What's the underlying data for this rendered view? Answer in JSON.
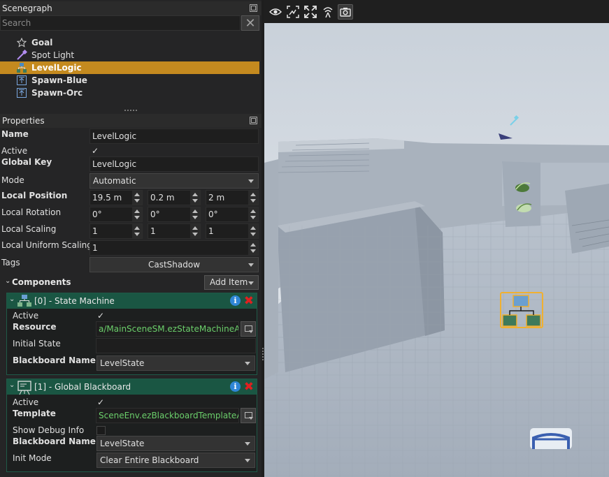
{
  "scenegraph": {
    "title": "Scenegraph",
    "search_placeholder": "Search",
    "items": [
      {
        "label": "Goal",
        "icon": "star-icon",
        "selected": false
      },
      {
        "label": "Spot Light",
        "icon": "spot-light-icon",
        "selected": false
      },
      {
        "label": "LevelLogic",
        "icon": "state-machine-icon",
        "selected": true
      },
      {
        "label": "Spawn-Blue",
        "icon": "spawn-point-icon",
        "selected": false
      },
      {
        "label": "Spawn-Orc",
        "icon": "spawn-point-icon",
        "selected": false
      }
    ]
  },
  "properties": {
    "title": "Properties",
    "name_label": "Name",
    "name_value": "LevelLogic",
    "active_label": "Active",
    "active_checked": "✓",
    "global_key_label": "Global Key",
    "global_key_value": "LevelLogic",
    "mode_label": "Mode",
    "mode_value": "Automatic",
    "local_position_label": "Local Position",
    "local_position": [
      "19.5 m",
      "0.2 m",
      "2 m"
    ],
    "local_rotation_label": "Local Rotation",
    "local_rotation": [
      "0°",
      "0°",
      "0°"
    ],
    "local_scaling_label": "Local Scaling",
    "local_scaling": [
      "1",
      "1",
      "1"
    ],
    "local_uniform_scaling_label": "Local Uniform Scaling",
    "local_uniform_scaling": "1",
    "tags_label": "Tags",
    "tags_value": "CastShadow"
  },
  "components": {
    "label": "Components",
    "add_item_label": "Add Item",
    "state_machine": {
      "title": "[0] - State Machine",
      "active_label": "Active",
      "active_checked": "✓",
      "resource_label": "Resource",
      "resource_value": "a/MainSceneSM.ezStateMachineAsset",
      "initial_state_label": "Initial State",
      "initial_state_value": "",
      "blackboard_name_label": "Blackboard Name",
      "blackboard_name_value": "LevelState"
    },
    "global_blackboard": {
      "title": "[1] - Global Blackboard",
      "active_label": "Active",
      "active_checked": "✓",
      "template_label": "Template",
      "template_value": "SceneEnv.ezBlackboardTemplateAsset",
      "show_debug_label": "Show Debug Info",
      "blackboard_name_label": "Blackboard Name",
      "blackboard_name_value": "LevelState",
      "init_mode_label": "Init Mode",
      "init_mode_value": "Clear Entire Blackboard"
    }
  },
  "viewport": {
    "toolbar_icons": [
      "eye-icon",
      "focus-select-icon",
      "fullscreen-icon",
      "broadcast-icon",
      "camera-icon"
    ],
    "active_tool": "camera-icon"
  },
  "colors": {
    "selection": "#c48a1f",
    "component_header": "#1a5643",
    "asset_text": "#6bcf6b",
    "delete": "#e02020",
    "info": "#2f86d6"
  }
}
